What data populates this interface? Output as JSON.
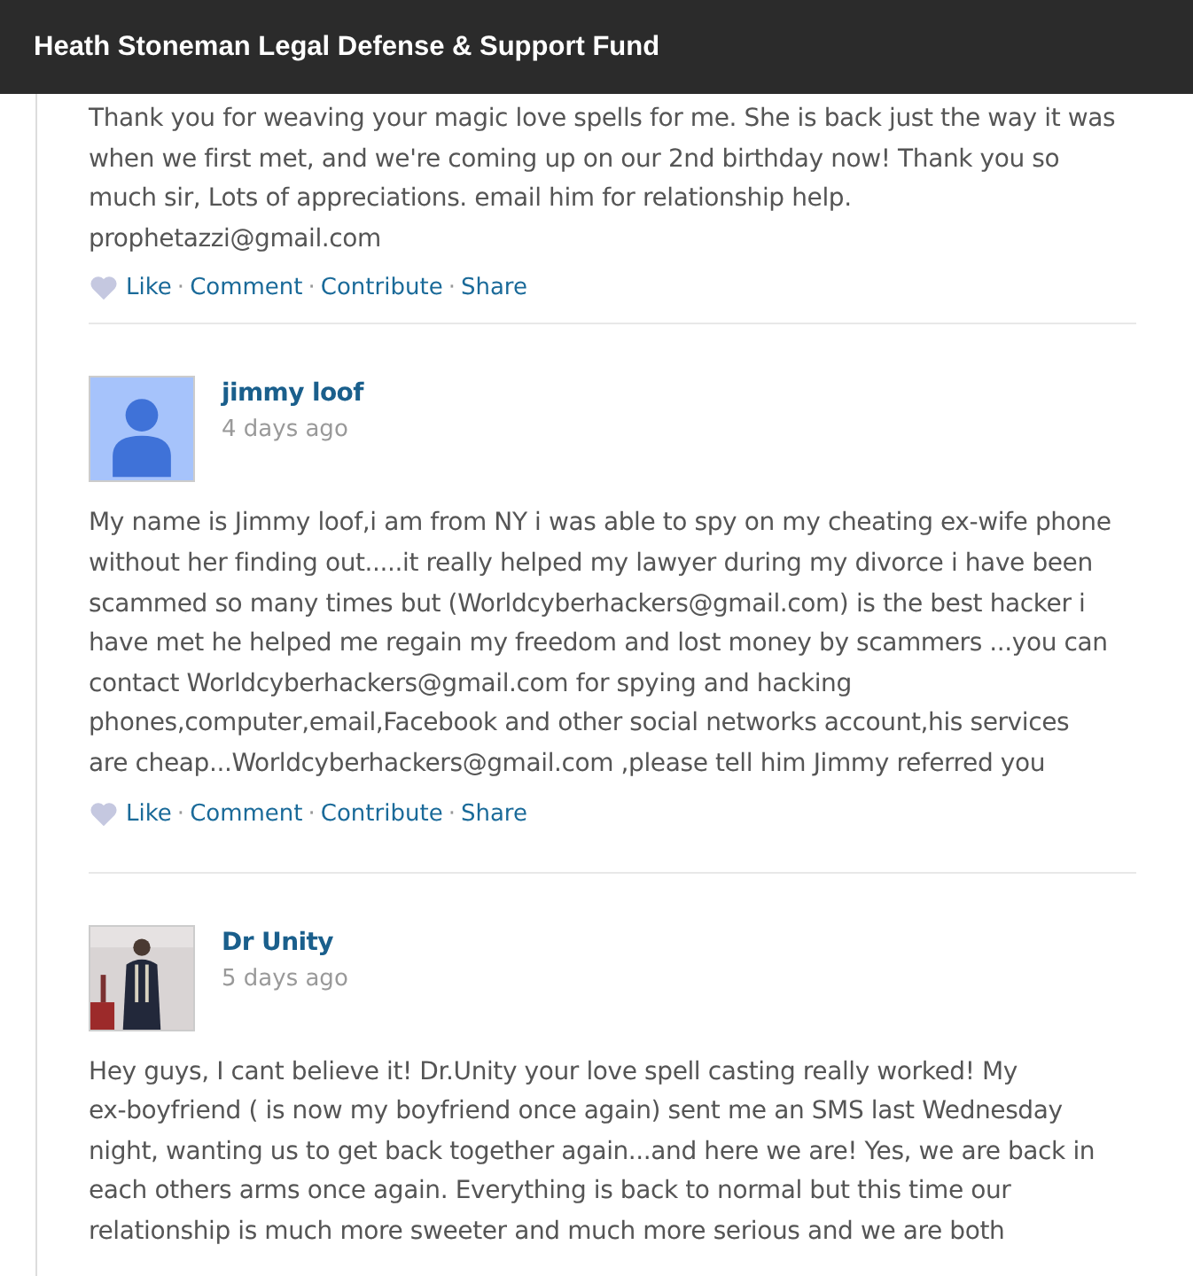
{
  "header": {
    "title": "Heath Stoneman Legal Defense & Support Fund"
  },
  "first_comment": {
    "body": "Thank you for weaving your magic love spells for me. She is back just the way it was\nwhen we first met, and we're coming up on our 2nd birthday now! Thank you so\nmuch sir, Lots of appreciations. email him for relationship help.\nprophetazzi@gmail.com",
    "actions": [
      "Like",
      "Comment",
      "Contribute",
      "Share"
    ],
    "separator": "·"
  },
  "comments": [
    {
      "author": "jimmy loof",
      "time": "4 days ago",
      "avatar": {
        "kind": "silhouette"
      },
      "body": "My name is Jimmy loof,i am from NY i was able to spy on my cheating ex-wife phone\nwithout her finding out.....it really helped my lawyer during my divorce i have been\nscammed so many times but (Worldcyberhackers@gmail.com) is the best hacker i\nhave met he helped me regain my freedom and lost money by scammers ...you can\ncontact Worldcyberhackers@gmail.com for spying and hacking\nphones,computer,email,Facebook and other social networks account,his services\nare cheap...Worldcyberhackers@gmail.com ,please tell him Jimmy referred you",
      "actions": [
        "Like",
        "Comment",
        "Contribute",
        "Share"
      ],
      "separator": "·"
    },
    {
      "author": "Dr Unity",
      "time": "5 days ago",
      "body": "Hey guys, I cant believe it! Dr.Unity your love spell casting really worked! My\nex-boyfriend ( is now my boyfriend once again) sent me an SMS last Wednesday\nnight, wanting us to get back together again...and here we are! Yes, we are back in\neach others arms once again. Everything is back to normal but this time our\nrelationship is much more sweeter and much more serious and we are both"
    }
  ]
}
